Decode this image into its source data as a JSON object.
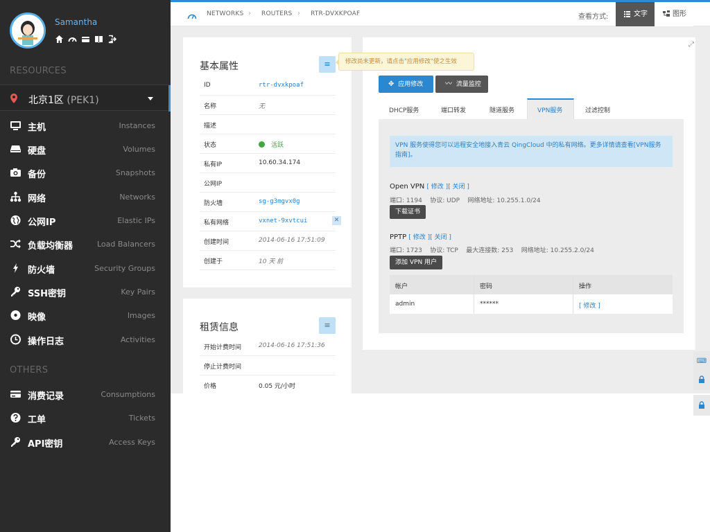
{
  "user": {
    "name": "Samantha"
  },
  "profile_icons": [
    "home-icon",
    "dashboard-icon",
    "card-icon",
    "book-icon",
    "logout-icon"
  ],
  "sidebar": {
    "resources_title": "RESOURCES",
    "region": {
      "name": "北京1区",
      "code": "(PEK1)"
    },
    "items": [
      {
        "zh": "主机",
        "en": "Instances",
        "icon": "monitor-icon"
      },
      {
        "zh": "硬盘",
        "en": "Volumes",
        "icon": "disk-icon"
      },
      {
        "zh": "备份",
        "en": "Snapshots",
        "icon": "camera-icon"
      },
      {
        "zh": "网络",
        "en": "Networks",
        "icon": "network-icon"
      },
      {
        "zh": "公网IP",
        "en": "Elastic IPs",
        "icon": "globe-icon"
      },
      {
        "zh": "负载均衡器",
        "en": "Load Balancers",
        "icon": "shuffle-icon"
      },
      {
        "zh": "防火墙",
        "en": "Security Groups",
        "icon": "bolt-icon"
      },
      {
        "zh": "SSH密钥",
        "en": "Key Pairs",
        "icon": "key-icon"
      },
      {
        "zh": "映像",
        "en": "Images",
        "icon": "disc-icon"
      },
      {
        "zh": "操作日志",
        "en": "Activities",
        "icon": "clock-icon"
      }
    ],
    "others_title": "OTHERS",
    "others": [
      {
        "zh": "消费记录",
        "en": "Consumptions",
        "icon": "card-icon"
      },
      {
        "zh": "工单",
        "en": "Tickets",
        "icon": "question-icon"
      },
      {
        "zh": "API密钥",
        "en": "Access Keys",
        "icon": "key-icon"
      }
    ]
  },
  "breadcrumb": [
    "NETWORKS",
    "ROUTERS",
    "RTR-DVXKPOAF"
  ],
  "view_mode": {
    "label": "查看方式:",
    "text": "文字",
    "graph": "图形"
  },
  "basic": {
    "title": "基本属性",
    "rows": [
      {
        "k": "ID",
        "v": "rtr-dvxkpoaf"
      },
      {
        "k": "名称",
        "v": "无"
      },
      {
        "k": "描述",
        "v": ""
      },
      {
        "k": "状态",
        "v": "活跃"
      },
      {
        "k": "私有IP",
        "v": "10.60.34.174"
      },
      {
        "k": "公网IP",
        "v": ""
      },
      {
        "k": "防火墙",
        "v": "sg-g3mgvx0g"
      },
      {
        "k": "私有网络",
        "v": "vxnet-9xvtcui"
      },
      {
        "k": "创建时间",
        "v": "2014-06-16 17:51:09"
      },
      {
        "k": "创建于",
        "v": "10 天 前"
      }
    ]
  },
  "lease": {
    "title": "租赁信息",
    "rows": [
      {
        "k": "开始计费时间",
        "v": "2014-06-16 17:51:36"
      },
      {
        "k": "停止计费时间",
        "v": ""
      },
      {
        "k": "价格",
        "v": "0.05",
        "unit": " 元/小时"
      }
    ]
  },
  "tooltip": "修改尚未更新，请点击\"应用修改\"使之生效",
  "actions": {
    "apply": "应用修改",
    "traffic": "流量监控"
  },
  "tabs": [
    "DHCP服务",
    "端口转发",
    "隧道服务",
    "VPN服务",
    "过滤控制"
  ],
  "active_tab": "VPN服务",
  "vpn": {
    "info_line1": "VPN 服务使得您可以远程安全地接入青云 QingCloud 中的私有网络。更多详情请查看[VPN服务",
    "info_line2": "指南]。",
    "openvpn": {
      "title": "Open VPN",
      "modify": "[ 修改 ]",
      "close": "[ 关闭 ]",
      "meta": "端口: 1194    协议: UDP    网络地址: 10.255.1.0/24",
      "button": "下载证书"
    },
    "pptp": {
      "title": "PPTP",
      "modify": "[ 修改 ]",
      "close": "[ 关闭 ]",
      "meta": "端口: 1723    协议: TCP    最大连接数: 253    网络地址: 10.255.2.0/24",
      "button": "添加 VPN 用户"
    },
    "table": {
      "headers": [
        "帐户",
        "密码",
        "操作"
      ],
      "rows": [
        {
          "account": "admin",
          "password": "******",
          "action": "[ 修改 ]"
        }
      ]
    }
  },
  "colors": {
    "accent": "#2a87d0",
    "sidebar_bg": "#2b2b2b",
    "active_green": "#3ea83f"
  }
}
